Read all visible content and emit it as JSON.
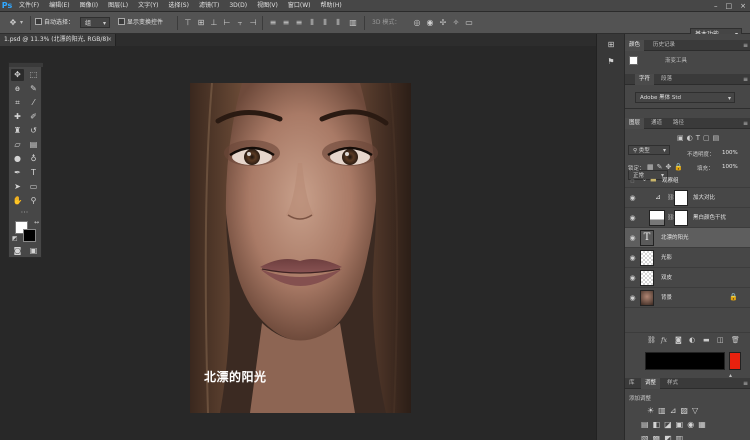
{
  "app": {
    "logo": "Ps"
  },
  "menu": [
    "文件(F)",
    "编辑(E)",
    "图像(I)",
    "图层(L)",
    "文字(Y)",
    "选择(S)",
    "滤镜(T)",
    "3D(D)",
    "视图(V)",
    "窗口(W)",
    "帮助(H)"
  ],
  "window_controls": [
    "–",
    "□",
    "×"
  ],
  "options": {
    "auto_select_label": "自动选择：",
    "auto_select_value": "组",
    "show_transform_label": "显示变换控件",
    "mode3d_label": "3D 模式：",
    "workspace": "基本功能"
  },
  "document": {
    "tab_title": "1.psd @ 11.3% (北漂的阳光, RGB/8)",
    "close": "×",
    "caption": "北漂的阳光"
  },
  "panels": {
    "color_tabs": [
      "颜色",
      "历史记录"
    ],
    "color_sub": "渐变工具",
    "char_tabs": [
      "字符",
      "段落"
    ],
    "font_family": "Adobe 黑体 Std",
    "layer_tabs": [
      "图层",
      "通道",
      "路径"
    ],
    "filter_kind": "类型",
    "blend_mode": "正常",
    "opacity_label": "不透明度：",
    "opacity_value": "100%",
    "lock_label": "锁定：",
    "fill_label": "填充：",
    "fill_value": "100%",
    "adjust_tabs": [
      "库",
      "调整",
      "样式"
    ],
    "adjust_title": "添加调整"
  },
  "layers": [
    {
      "name": "观察组",
      "kind": "group"
    },
    {
      "name": "加大对比",
      "kind": "adjustment"
    },
    {
      "name": "黑白颜色干扰",
      "kind": "adjustment-mask"
    },
    {
      "name": "北漂的阳光",
      "kind": "text",
      "selected": true
    },
    {
      "name": "光影",
      "kind": "pixel"
    },
    {
      "name": "双皮",
      "kind": "pixel"
    },
    {
      "name": "背景",
      "kind": "background",
      "locked": true
    }
  ],
  "colors": {
    "accent_blue": "#31a8ff",
    "panel_bg": "#474747",
    "canvas_bg": "#282828",
    "foreground": "#ffffff",
    "background": "#000000",
    "gradient_red": "#e8210e"
  }
}
